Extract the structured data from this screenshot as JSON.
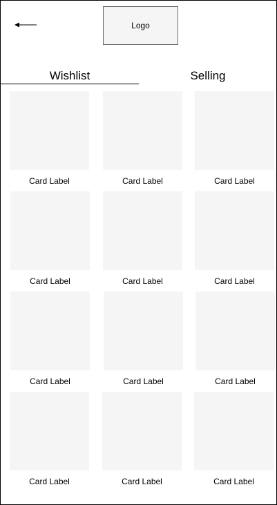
{
  "header": {
    "back_icon": "arrow-left-icon",
    "logo_text": "Logo"
  },
  "tabs": [
    {
      "label": "Wishlist",
      "active": true
    },
    {
      "label": "Selling",
      "active": false
    }
  ],
  "cards": [
    {
      "label": "Card Label"
    },
    {
      "label": "Card Label"
    },
    {
      "label": "Card Label"
    },
    {
      "label": "Card Label"
    },
    {
      "label": "Card Label"
    },
    {
      "label": "Card Label"
    },
    {
      "label": "Card Label"
    },
    {
      "label": "Card Label"
    },
    {
      "label": "Card Label"
    },
    {
      "label": "Card Label"
    },
    {
      "label": "Card Label"
    },
    {
      "label": "Card Label"
    }
  ]
}
